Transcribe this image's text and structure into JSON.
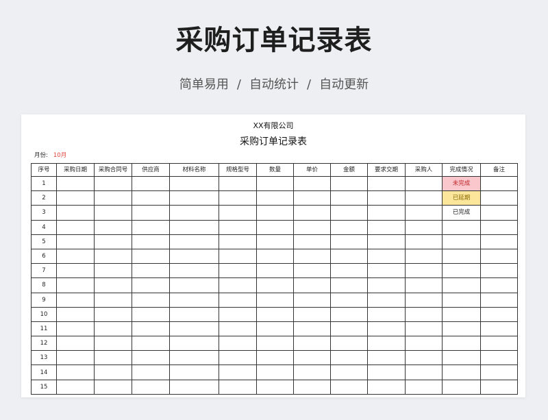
{
  "hero": {
    "title": "采购订单记录表",
    "subtitle_parts": [
      "简单易用",
      "/",
      "自动统计",
      "/",
      "自动更新"
    ]
  },
  "sheet": {
    "company": "XX有限公司",
    "title": "采购订单记录表",
    "month_label": "月份:",
    "month_value": "10月",
    "columns": [
      "序号",
      "采购日期",
      "采购合同号",
      "供应商",
      "材料名称",
      "规格型号",
      "数量",
      "单价",
      "金额",
      "要求交期",
      "采购人",
      "完成情况",
      "备注"
    ],
    "rows": [
      {
        "no": "1",
        "status": "未完成",
        "status_style": "red"
      },
      {
        "no": "2",
        "status": "已延期",
        "status_style": "yellow"
      },
      {
        "no": "3",
        "status": "已完成",
        "status_style": "none"
      },
      {
        "no": "4",
        "status": "",
        "status_style": "none"
      },
      {
        "no": "5",
        "status": "",
        "status_style": "none"
      },
      {
        "no": "6",
        "status": "",
        "status_style": "none"
      },
      {
        "no": "7",
        "status": "",
        "status_style": "none"
      },
      {
        "no": "8",
        "status": "",
        "status_style": "none"
      },
      {
        "no": "9",
        "status": "",
        "status_style": "none"
      },
      {
        "no": "10",
        "status": "",
        "status_style": "none"
      },
      {
        "no": "11",
        "status": "",
        "status_style": "none"
      },
      {
        "no": "12",
        "status": "",
        "status_style": "none"
      },
      {
        "no": "13",
        "status": "",
        "status_style": "none"
      },
      {
        "no": "14",
        "status": "",
        "status_style": "none"
      },
      {
        "no": "15",
        "status": "",
        "status_style": "none"
      }
    ],
    "status_colors": {
      "red_bg": "#f9c7cc",
      "red_text": "#c0262b",
      "yellow_bg": "#fce69c",
      "yellow_text": "#8a6a00"
    }
  }
}
